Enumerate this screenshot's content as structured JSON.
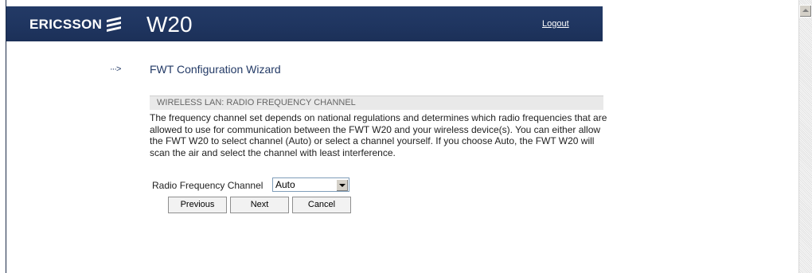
{
  "header": {
    "brand": "ERICSSON",
    "product": "W20",
    "logout_label": "Logout"
  },
  "wizard": {
    "arrow": "···>",
    "title": "FWT Configuration Wizard",
    "section_title": "WIRELESS LAN: RADIO FREQUENCY CHANNEL",
    "description": "The frequency channel set depends on national regulations and determines which radio frequencies that are allowed to use for communication between the FWT W20 and your wireless device(s). You can either allow the FWT W20 to select channel (Auto) or select a channel yourself. If you choose Auto, the FWT W20 will scan the air and select the channel with least interference.",
    "field_label": "Radio Frequency Channel",
    "field_value": "Auto"
  },
  "buttons": {
    "previous": "Previous",
    "next": "Next",
    "cancel": "Cancel"
  },
  "colors": {
    "header_bg": "#233a66",
    "title_color": "#233a66",
    "section_bar": "#e9e9e9"
  },
  "icons": {
    "logo": "ericsson-logo-icon",
    "arrow": "dotted-arrow-icon",
    "dropdown": "chevron-down-icon",
    "scroll_up": "scroll-up-arrow-icon"
  }
}
